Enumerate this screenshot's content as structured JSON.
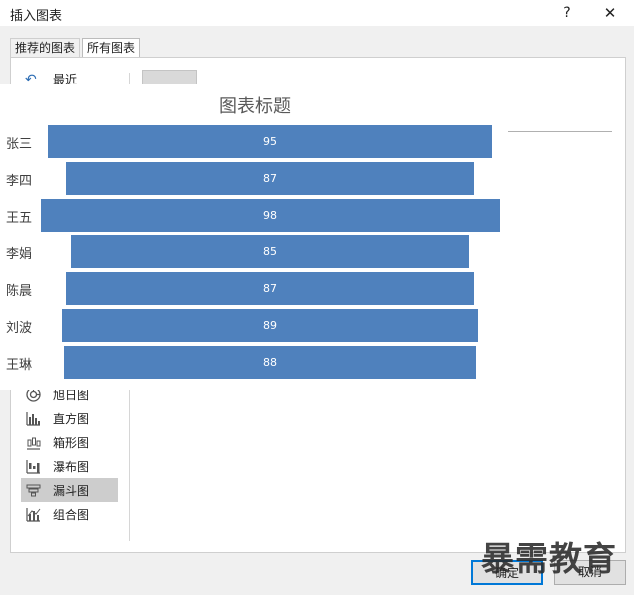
{
  "dialog": {
    "title": "插入图表",
    "help_label": "?",
    "close_label": "✕"
  },
  "tabs": [
    {
      "label": "推荐的图表",
      "active": false
    },
    {
      "label": "所有图表",
      "active": true
    }
  ],
  "left_list": {
    "recent_label": "最近",
    "items": [
      {
        "label": "旭日图",
        "icon": "sunburst-icon",
        "selected": false
      },
      {
        "label": "直方图",
        "icon": "histogram-icon",
        "selected": false
      },
      {
        "label": "箱形图",
        "icon": "box-whisker-icon",
        "selected": false
      },
      {
        "label": "瀑布图",
        "icon": "waterfall-icon",
        "selected": false
      },
      {
        "label": "漏斗图",
        "icon": "funnel-icon",
        "selected": true
      },
      {
        "label": "组合图",
        "icon": "combo-chart-icon",
        "selected": false
      }
    ]
  },
  "buttons": {
    "ok_label": "确定",
    "cancel_label": "取消"
  },
  "watermark": "暴需教育",
  "colors": {
    "bar": "#4f81bd",
    "selected_item": "#cdcdcd",
    "accent": "#0078d7"
  },
  "chart_data": {
    "type": "bar",
    "subtype": "funnel",
    "title": "图表标题",
    "categories": [
      "张三",
      "李四",
      "王五",
      "李娟",
      "陈晨",
      "刘波",
      "王琳"
    ],
    "values": [
      95,
      87,
      98,
      85,
      87,
      89,
      88
    ]
  }
}
